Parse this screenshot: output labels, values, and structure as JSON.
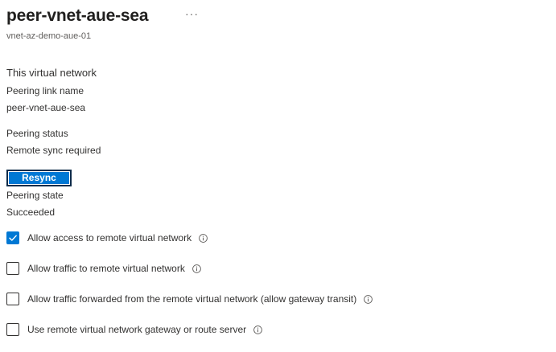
{
  "header": {
    "title": "peer-vnet-aue-sea",
    "more_label": "···",
    "subtitle": "vnet-az-demo-aue-01"
  },
  "section": {
    "heading": "This virtual network"
  },
  "fields": {
    "peering_link_name_label": "Peering link name",
    "peering_link_name_value": "peer-vnet-aue-sea",
    "peering_status_label": "Peering status",
    "peering_status_value": "Remote sync required",
    "peering_state_label": "Peering state",
    "peering_state_value": "Succeeded"
  },
  "actions": {
    "resync_label": "Resync"
  },
  "options": [
    {
      "label": "Allow access to remote virtual network",
      "checked": true
    },
    {
      "label": "Allow traffic to remote virtual network",
      "checked": false
    },
    {
      "label": "Allow traffic forwarded from the remote virtual network (allow gateway transit)",
      "checked": false
    },
    {
      "label": "Use remote virtual network gateway or route server",
      "checked": false
    }
  ],
  "colors": {
    "accent": "#0078d4",
    "button_border": "#0f2c4a",
    "text": "#323130",
    "muted": "#605e5c"
  },
  "icons": {
    "more": "more-icon",
    "info": "info-icon",
    "check": "checkmark-icon"
  }
}
